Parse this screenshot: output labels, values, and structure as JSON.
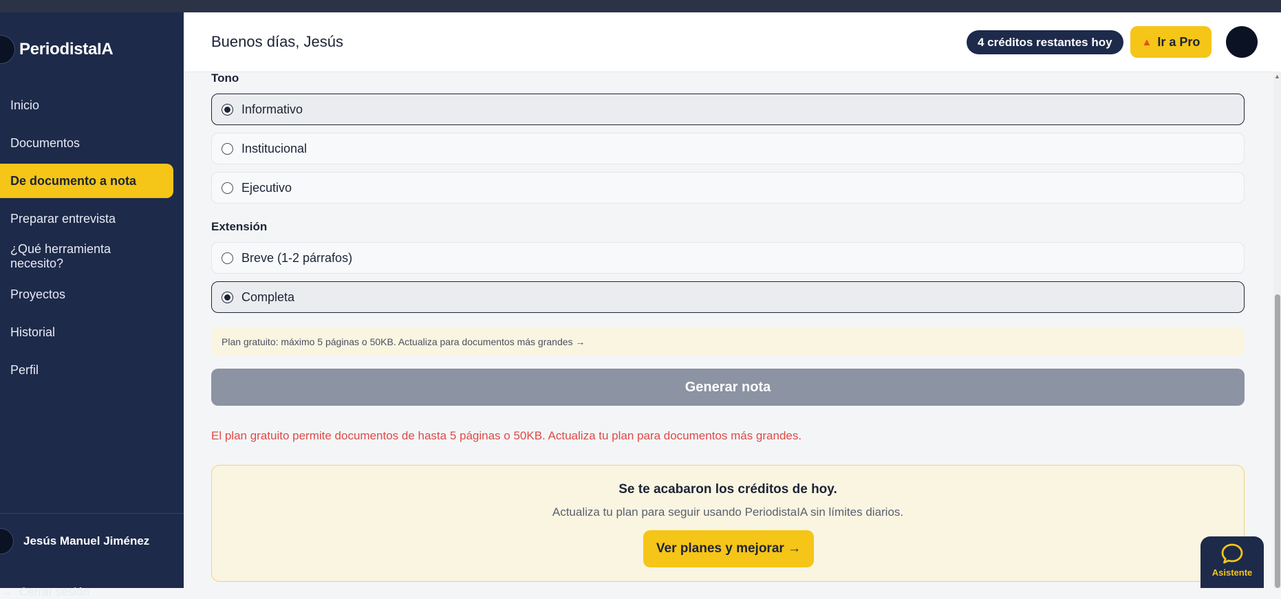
{
  "sidebar": {
    "brand": "PeriodistaIA",
    "items": [
      {
        "label": "Inicio",
        "active": false
      },
      {
        "label": "Documentos",
        "active": false
      },
      {
        "label": "De documento a nota",
        "active": true
      },
      {
        "label": "Preparar entrevista",
        "active": false
      },
      {
        "label": "¿Qué herramienta necesito?",
        "active": false
      },
      {
        "label": "Proyectos",
        "active": false
      },
      {
        "label": "Historial",
        "active": false
      },
      {
        "label": "Perfil",
        "active": false
      }
    ],
    "user_name": "Jesús Manuel Jiménez",
    "logout_label": "Cerrar sesión"
  },
  "header": {
    "greeting": "Buenos días, Jesús",
    "credits": "4 créditos restantes hoy",
    "pro_label": "Ir a Pro"
  },
  "form": {
    "tone_label": "Tono",
    "tone_options": [
      {
        "label": "Informativo",
        "selected": true
      },
      {
        "label": "Institucional",
        "selected": false
      },
      {
        "label": "Ejecutivo",
        "selected": false
      }
    ],
    "length_label": "Extensión",
    "length_options": [
      {
        "label": "Breve (1-2 párrafos)",
        "selected": false
      },
      {
        "label": "Completa",
        "selected": true
      }
    ],
    "plan_notice": "Plan gratuito: máximo 5 páginas o 50KB. Actualiza para documentos más grandes →",
    "generate_label": "Generar nota",
    "error_text": "El plan gratuito permite documentos de hasta 5 páginas o 50KB. Actualiza tu plan para documentos más grandes."
  },
  "upgrade": {
    "title": "Se te acabaron los créditos de hoy.",
    "subtitle": "Actualiza tu plan para seguir usando PeriodistaIA sin límites diarios.",
    "button_label": "Ver planes y mejorar →"
  },
  "assistant": {
    "label": "Asistente"
  },
  "colors": {
    "sidebar_bg": "#1e2a4a",
    "accent": "#f5c518",
    "error": "#df4a45",
    "disabled_button": "#8c93a3"
  }
}
